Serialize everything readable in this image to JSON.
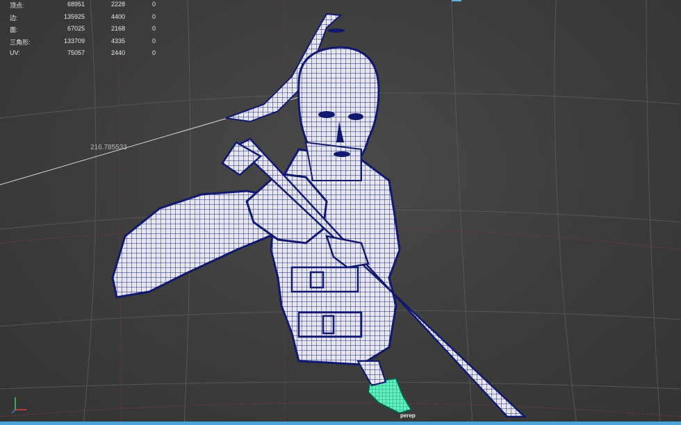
{
  "hud": {
    "rows": [
      {
        "label": "顶点:",
        "total": "68951",
        "selected": "2228",
        "compare": "0"
      },
      {
        "label": "边:",
        "total": "135925",
        "selected": "4400",
        "compare": "0"
      },
      {
        "label": "面:",
        "total": "67025",
        "selected": "2168",
        "compare": "0"
      },
      {
        "label": "三角形:",
        "total": "133709",
        "selected": "4335",
        "compare": "0"
      },
      {
        "label": "UV:",
        "total": "75057",
        "selected": "2440",
        "compare": "0"
      }
    ]
  },
  "viewport": {
    "dimension_value": "216.785533",
    "object_label": "perep"
  },
  "colors": {
    "background": "#3c3c3c",
    "wireframe": "#101870",
    "mesh_fill": "#e6e6ec",
    "selection": "#4fe6b0",
    "grid": "#5a5a5a",
    "status_bar": "#4aa3d6"
  },
  "icons": {
    "axis": "axis-gizmo-icon"
  }
}
